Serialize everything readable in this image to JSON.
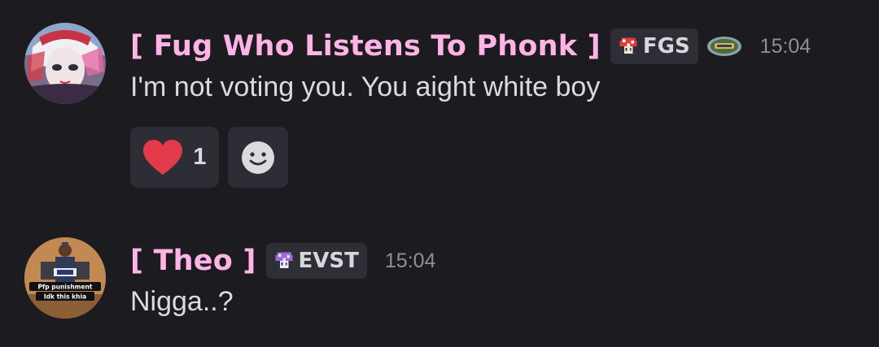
{
  "messages": [
    {
      "author": "[ Fug Who Listens To Phonk ]",
      "tag": {
        "icon": "red-mushroom-icon",
        "label": "FGS",
        "color": "#e23c3c"
      },
      "extra_badge_icon": "server-banner-badge-icon",
      "timestamp": "15:04",
      "content": "I'm not voting you. You aight white boy",
      "reactions": [
        {
          "emoji": "red-heart-icon",
          "count": "1"
        }
      ],
      "add_reaction_icon": "smiley-face-icon"
    },
    {
      "author": "[ Theo ]",
      "tag": {
        "icon": "purple-mushroom-icon",
        "label": "EVST",
        "color": "#9b6bd6"
      },
      "timestamp": "15:04",
      "content": "Nigga..?",
      "avatar_caption": [
        "Pfp punishment",
        "Idk this khia"
      ]
    }
  ],
  "colors": {
    "background": "#1b1b20",
    "username": "#ffb3e6",
    "timestamp": "#8e9099",
    "tag_background": "#2e2f36",
    "reaction_background": "#2d2e35",
    "heart": "#e23a48"
  }
}
